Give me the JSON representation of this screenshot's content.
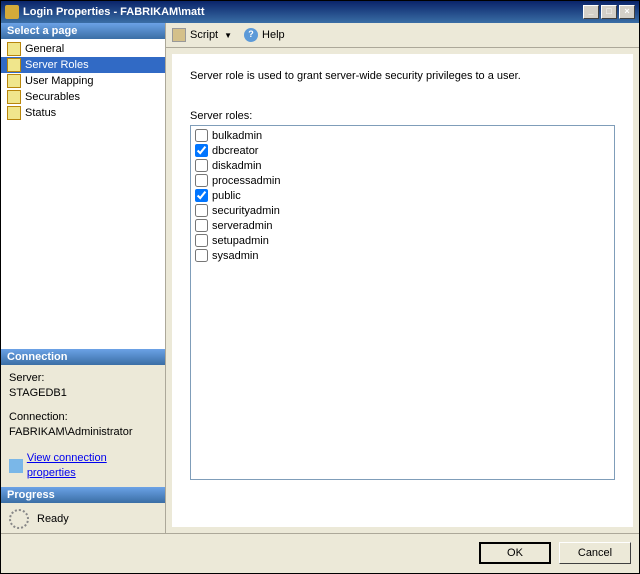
{
  "window": {
    "title": "Login Properties - FABRIKAM\\matt"
  },
  "left": {
    "select_header": "Select a page",
    "pages": [
      {
        "label": "General"
      },
      {
        "label": "Server Roles"
      },
      {
        "label": "User Mapping"
      },
      {
        "label": "Securables"
      },
      {
        "label": "Status"
      }
    ],
    "connection_header": "Connection",
    "server_label": "Server:",
    "server_value": "STAGEDB1",
    "connection_label": "Connection:",
    "connection_value": "FABRIKAM\\Administrator",
    "view_conn_link": "View connection properties",
    "progress_header": "Progress",
    "progress_status": "Ready"
  },
  "toolbar": {
    "script": "Script",
    "help": "Help"
  },
  "content": {
    "description": "Server role is used to grant server-wide security privileges to a user.",
    "roles_label": "Server roles:",
    "roles": [
      {
        "name": "bulkadmin",
        "checked": false
      },
      {
        "name": "dbcreator",
        "checked": true
      },
      {
        "name": "diskadmin",
        "checked": false
      },
      {
        "name": "processadmin",
        "checked": false
      },
      {
        "name": "public",
        "checked": true
      },
      {
        "name": "securityadmin",
        "checked": false
      },
      {
        "name": "serveradmin",
        "checked": false
      },
      {
        "name": "setupadmin",
        "checked": false
      },
      {
        "name": "sysadmin",
        "checked": false
      }
    ]
  },
  "footer": {
    "ok": "OK",
    "cancel": "Cancel"
  }
}
